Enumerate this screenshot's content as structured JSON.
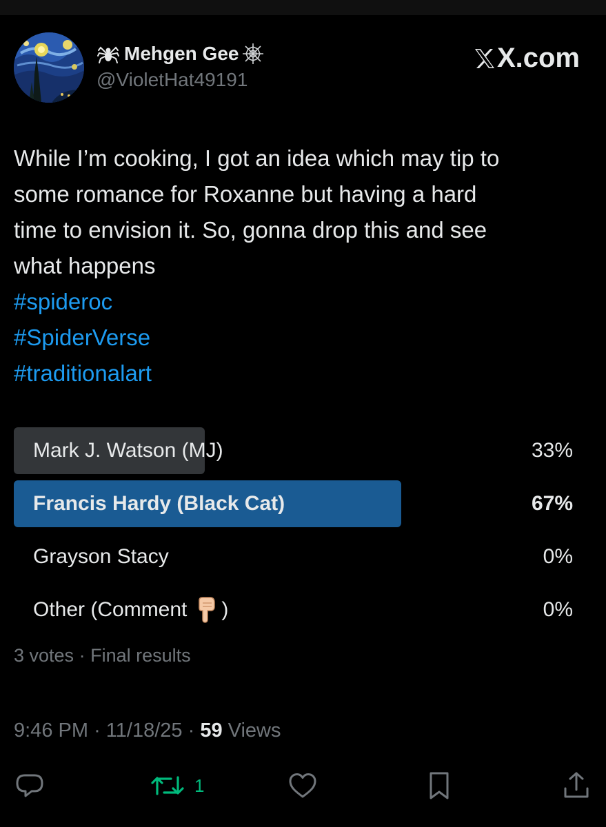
{
  "brand": {
    "label": "X.com"
  },
  "author": {
    "display_name": "Mehgen Gee",
    "handle": "@VioletHat49191"
  },
  "post": {
    "text_lines": [
      "While I’m cooking, I got an idea which may tip to",
      "some romance for Roxanne but having a hard",
      "time to envision it. So, gonna drop this and see",
      "what happens"
    ],
    "hashtags": [
      "#spideroc",
      "#SpiderVerse",
      "#traditionalart"
    ]
  },
  "poll": {
    "options": [
      {
        "label": "Mark J. Watson (MJ)",
        "percent_label": "33%",
        "share": 0.33,
        "winner": false
      },
      {
        "label": "Francis Hardy (Black Cat)",
        "percent_label": "67%",
        "share": 0.67,
        "winner": true
      },
      {
        "label": "Grayson Stacy",
        "percent_label": "0%",
        "share": 0.0,
        "winner": false
      },
      {
        "label": "Other (Comment",
        "label_suffix": ")",
        "percent_label": "0%",
        "share": 0.0,
        "winner": false
      }
    ],
    "votes_label": "3 votes",
    "separator": "·",
    "status_label": "Final results"
  },
  "meta": {
    "time": "9:46 PM",
    "date": "11/18/25",
    "separator": "·",
    "views_count": "59",
    "views_label": "Views"
  },
  "actions": {
    "reply_icon": "reply-icon",
    "repost_icon": "repost-icon",
    "repost_count": "1",
    "like_icon": "heart-icon",
    "bookmark_icon": "bookmark-icon",
    "share_icon": "share-icon"
  },
  "colors": {
    "background": "#000000",
    "text": "#e7e9ea",
    "muted": "#71767b",
    "link": "#1d9bf0",
    "poll_winner_bar": "#1a5b93",
    "poll_loser_bar": "#333639",
    "repost_green": "#00ba7c"
  }
}
